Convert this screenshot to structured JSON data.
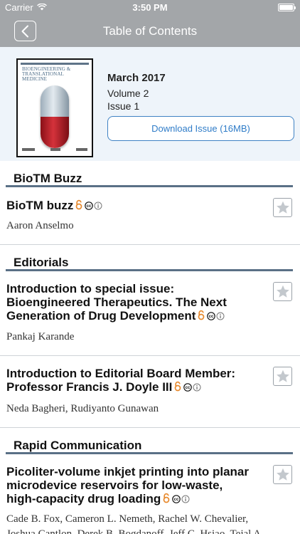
{
  "status_bar": {
    "carrier": "Carrier",
    "time": "3:50 PM",
    "battery_level": 1.0
  },
  "nav": {
    "title": "Table of Contents",
    "back_icon": "chevron-left-icon"
  },
  "issue": {
    "cover_journal_title": "BIOENGINEERING & TRANSLATIONAL MEDICINE",
    "date": "March 2017",
    "volume": "Volume 2",
    "number": "Issue 1",
    "download_label": "Download Issue (16MB)"
  },
  "sections": [
    {
      "heading": "BioTM Buzz",
      "articles": [
        {
          "title": "BioTM buzz",
          "authors": "Aaron Anselmo",
          "badges": [
            "open-access-icon",
            "creative-commons-icon"
          ]
        }
      ]
    },
    {
      "heading": "Editorials",
      "articles": [
        {
          "title_lines": [
            "Introduction to special issue:",
            "Bioengineered Therapeutics. The Next",
            "Generation of Drug Development"
          ],
          "authors": "Pankaj Karande",
          "badges": [
            "open-access-icon",
            "creative-commons-icon"
          ]
        },
        {
          "title_lines": [
            "Introduction to Editorial Board Member:",
            "Professor Francis J. Doyle III"
          ],
          "authors": "Neda Bagheri, Rudiyanto Gunawan",
          "badges": [
            "open-access-icon",
            "creative-commons-icon"
          ]
        }
      ]
    },
    {
      "heading": "Rapid Communication",
      "articles": [
        {
          "title_lines": [
            "Picoliter-volume inkjet printing into planar",
            "microdevice reservoirs for low-waste,",
            "high-capacity drug loading"
          ],
          "authors_lines": [
            "Cade B. Fox, Cameron L. Nemeth, Rachel W. Chevalier,",
            "Joshua Cantlon, Derek B. Bogdanoff, Jeff C. Hsiao, Tejal A."
          ],
          "badges": [
            "open-access-icon",
            "creative-commons-icon"
          ]
        }
      ]
    }
  ],
  "colors": {
    "nav_bar": "#a3a6a9",
    "issue_bg": "#eef4fa",
    "accent_blue": "#2f7cc8",
    "section_rule": "#5a7086",
    "open_access_orange": "#e88a2e"
  }
}
